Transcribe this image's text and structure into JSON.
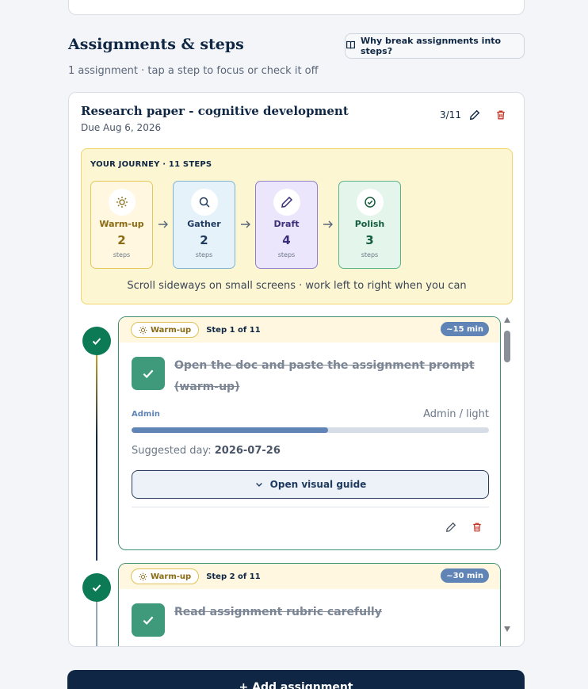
{
  "section": {
    "title": "Assignments & steps",
    "subtitle": "1 assignment · tap a step to focus or check it off",
    "why_button": "Why break assignments into steps?"
  },
  "assignment": {
    "title": "Research paper - cognitive development",
    "due": "Due Aug 6, 2026",
    "count": "3/11",
    "journey": {
      "label": "YOUR JOURNEY · 11 STEPS",
      "hint": "Scroll sideways on small screens · work left to right when you can",
      "phases": [
        {
          "name": "Warm-up",
          "count": "2",
          "unit": "steps",
          "icon": "sun-icon",
          "bg": "#fff7e0",
          "border": "#e6c75c",
          "color": "#8a6b14"
        },
        {
          "name": "Gather",
          "count": "2",
          "unit": "steps",
          "icon": "search-icon",
          "bg": "#e6f2fa",
          "border": "#7fb3d5",
          "color": "#1f3a5f"
        },
        {
          "name": "Draft",
          "count": "4",
          "unit": "steps",
          "icon": "pencil-icon",
          "bg": "#ebe6fb",
          "border": "#8f7fce",
          "color": "#3b2f7a"
        },
        {
          "name": "Polish",
          "count": "3",
          "unit": "steps",
          "icon": "check-circle-icon",
          "bg": "#e4f5ec",
          "border": "#5ab38a",
          "color": "#135c3e"
        }
      ]
    },
    "steps": [
      {
        "phase": "Warm-up",
        "step_of": "Step 1 of 11",
        "time": "~15 min",
        "title_line1": "Open the doc and paste the assignment prompt",
        "title_line2": "(warm-up)",
        "category": "Admin",
        "category_detail": "Admin / light",
        "progress": 0.55,
        "suggested_label": "Suggested day:",
        "suggested_day": "2026-07-26",
        "guide_button": "Open visual guide",
        "done": true
      },
      {
        "phase": "Warm-up",
        "step_of": "Step 2 of 11",
        "time": "~30 min",
        "title_line1": "Read assignment rubric carefully",
        "done": true
      }
    ]
  },
  "add_button": "+ Add assignment",
  "colors": {
    "navy": "#0f2744",
    "done_green": "#0b7a55",
    "accent_blue": "#5f84b5",
    "delete_red": "#c0392b"
  }
}
